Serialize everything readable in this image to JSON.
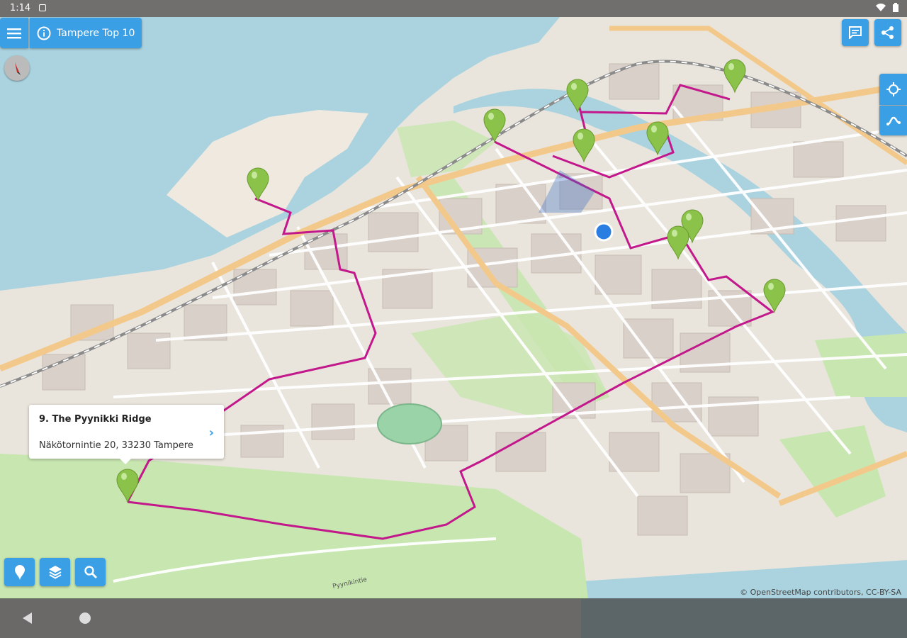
{
  "status_bar": {
    "time": "1:14"
  },
  "header": {
    "title": "Tampere Top 10"
  },
  "popup": {
    "title": "9. The Pyynikki Ridge",
    "address": "Näkötornintie 20, 33230 Tampere"
  },
  "attribution": "© OpenStreetMap contributors, CC-BY-SA",
  "map": {
    "place_labels": [
      "Pyynikintie"
    ],
    "marker_count": 10
  },
  "colors": {
    "accent": "#3b9fe6",
    "route": "#c2188c",
    "marker": "#8bc34a",
    "water": "#aad3df",
    "park": "#c8e6b0"
  }
}
